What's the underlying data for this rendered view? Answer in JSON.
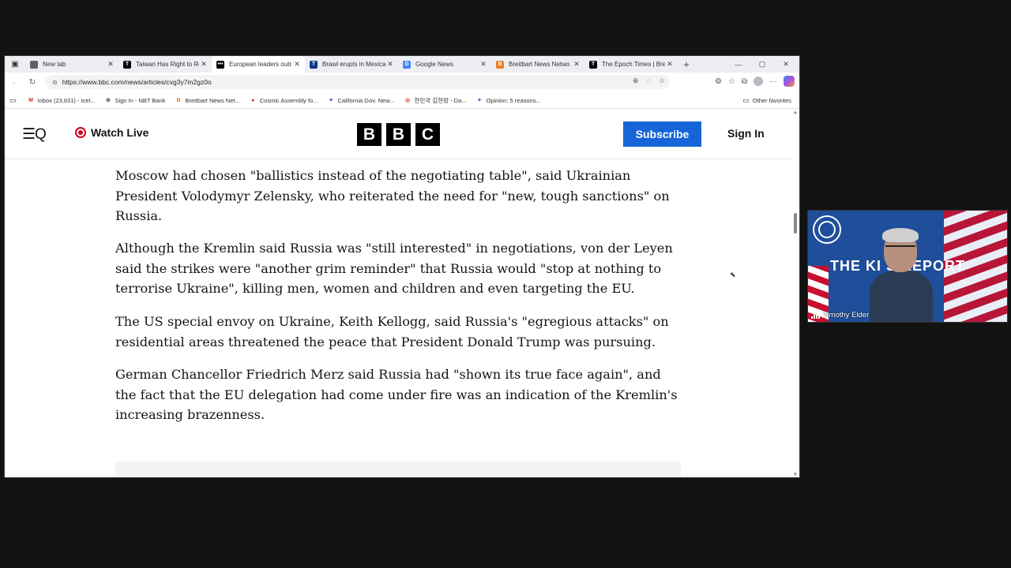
{
  "browser": {
    "tabs": [
      {
        "title": "New tab",
        "favicon": "new-tab-icon",
        "color": "#5f6368",
        "glyph": ""
      },
      {
        "title": "Taiwan Has Right to Re",
        "favicon": "epoch-times-icon",
        "color": "#000000",
        "glyph": "T"
      },
      {
        "title": "European leaders outr",
        "favicon": "bbc-icon",
        "color": "#000000",
        "glyph": "•••",
        "active": true
      },
      {
        "title": "Brawl erupts in Mexica",
        "favicon": "epoch-times-icon",
        "color": "#0b3a8a",
        "glyph": "T"
      },
      {
        "title": "Google News",
        "favicon": "google-news-icon",
        "color": "#4285f4",
        "glyph": "G"
      },
      {
        "title": "Breitbart News Netwo",
        "favicon": "breitbart-icon",
        "color": "#f47b20",
        "glyph": "B"
      },
      {
        "title": "The Epoch Times | Bre",
        "favicon": "epoch-times-icon",
        "color": "#000000",
        "glyph": "T"
      }
    ],
    "url": "https://www.bbc.com/news/articles/cvg3y7m2gz0o",
    "favorites": [
      {
        "label": "Inbox (23,631) - tcel...",
        "icon": "gmail-icon",
        "color": "#d93025",
        "glyph": "M"
      },
      {
        "label": "Sign In - NBT Bank",
        "icon": "globe-icon",
        "color": "#555555",
        "glyph": "⊕"
      },
      {
        "label": "Breitbart News Net...",
        "icon": "breitbart-icon",
        "color": "#f47b20",
        "glyph": "B"
      },
      {
        "label": "Cosmic Assembly fo...",
        "icon": "cosmic-icon",
        "color": "#d93025",
        "glyph": "●"
      },
      {
        "label": "California Gov. New...",
        "icon": "news-icon",
        "color": "#6b4fd8",
        "glyph": "✦"
      },
      {
        "label": "한민국 김현방 - Da...",
        "icon": "daum-icon",
        "color": "#e33b3b",
        "glyph": "◎"
      },
      {
        "label": "Opinion: 5 reasons...",
        "icon": "news-icon",
        "color": "#6b4fd8",
        "glyph": "✦"
      }
    ],
    "other_favorites": "Other favorites"
  },
  "bbc": {
    "watch_live": "Watch Live",
    "logo_letters": [
      "B",
      "B",
      "C"
    ],
    "subscribe": "Subscribe",
    "sign_in": "Sign In",
    "accent": "#1565d8",
    "live_color": "#d3001f"
  },
  "article": {
    "paragraphs": [
      "Moscow had chosen \"ballistics instead of the negotiating table\", said Ukrainian President Volodymyr Zelensky, who reiterated the need for \"new, tough sanctions\" on Russia.",
      "Although the Kremlin said Russia was \"still interested\" in negotiations, von der Leyen said the strikes were \"another grim reminder\" that Russia would \"stop at nothing to terrorise Ukraine\", killing men, women and children and even targeting the EU.",
      "The US special envoy on Ukraine, Keith Kellogg, said Russia's \"egregious attacks\" on residential areas threatened the peace that President Donald Trump was pursuing.",
      "German Chancellor Friedrich Merz said Russia had \"shown its true face again\", and the fact that the EU delegation had come under fire was an indication of the Kremlin's increasing brazenness."
    ]
  },
  "video": {
    "title": "THE KI    S REPORT",
    "participant": "Timothy Elder"
  }
}
